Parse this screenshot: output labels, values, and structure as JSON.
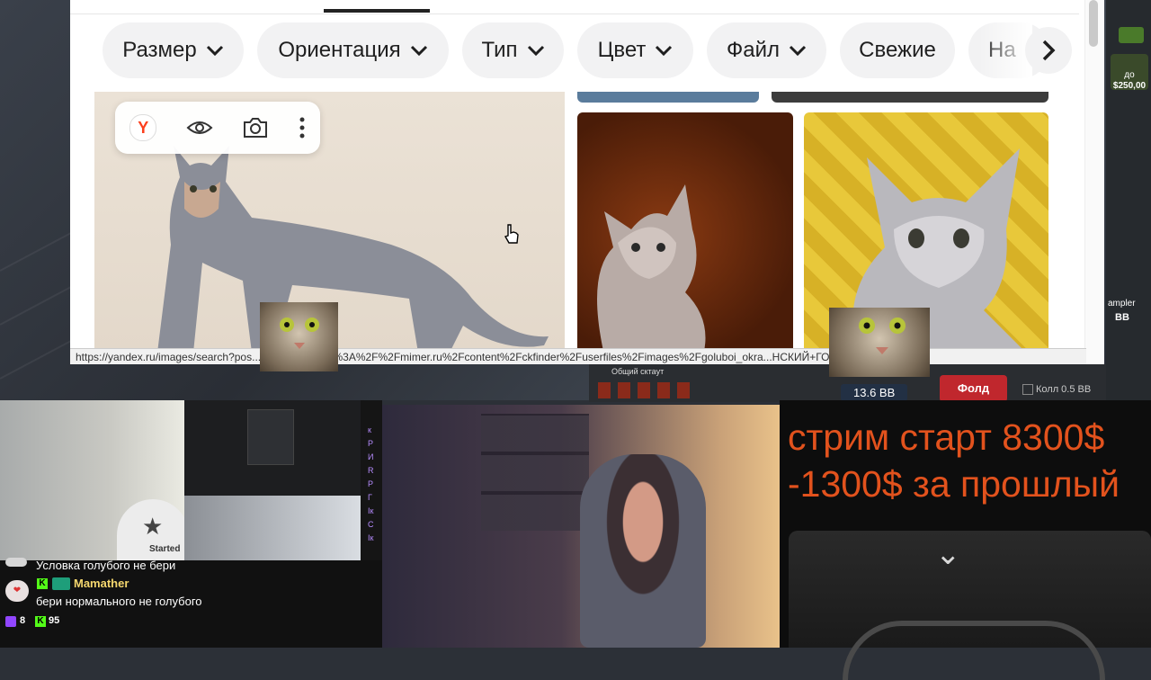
{
  "browser": {
    "filters": [
      "Размер",
      "Ориентация",
      "Тип",
      "Цвет",
      "Файл",
      "Свежие",
      "На"
    ],
    "status_url": "https://yandex.ru/images/search?pos...&img_url=https%3A%2F%2Fmimer.ru%2Fcontent%2Fckfinder%2Fuserfiles%2Fimages%2Fgoluboi_okra...НСКИЙ+ГОЛУБОЙ&rpt=sima...",
    "toolbar_icons": [
      "yandex-icon",
      "eye-icon",
      "camera-icon",
      "more-icon"
    ]
  },
  "casino": {
    "overall_label": "Общий сктаут",
    "balance": "13.6 BB",
    "fold_button": "Фолд",
    "call_label": "Колл 0.5 BB"
  },
  "side_panel": {
    "prize_line1": "до",
    "prize_line2": "$250,00",
    "sampler": "ampler",
    "bb": "BB"
  },
  "webcam": {
    "cap_text": "Started"
  },
  "screen_share": {
    "chat_letters": [
      "к",
      "Р",
      "И",
      "R",
      "Р",
      "Г",
      "Ік",
      "С",
      "Ік"
    ]
  },
  "chat": {
    "line1": "Условка голубого не бери",
    "user": "Mamather",
    "message": "бери нормального не голубого",
    "sub_count": "8",
    "kick_count": "95"
  },
  "banner": {
    "line1": "стрим старт 8300$",
    "line2": "-1300$ за прошлый"
  },
  "colors": {
    "banner_text": "#e2521d",
    "fold_red": "#c0272d",
    "twitch_purple": "#9146ff",
    "kick_green": "#53fc18",
    "username_yellow": "#f5d76e"
  }
}
